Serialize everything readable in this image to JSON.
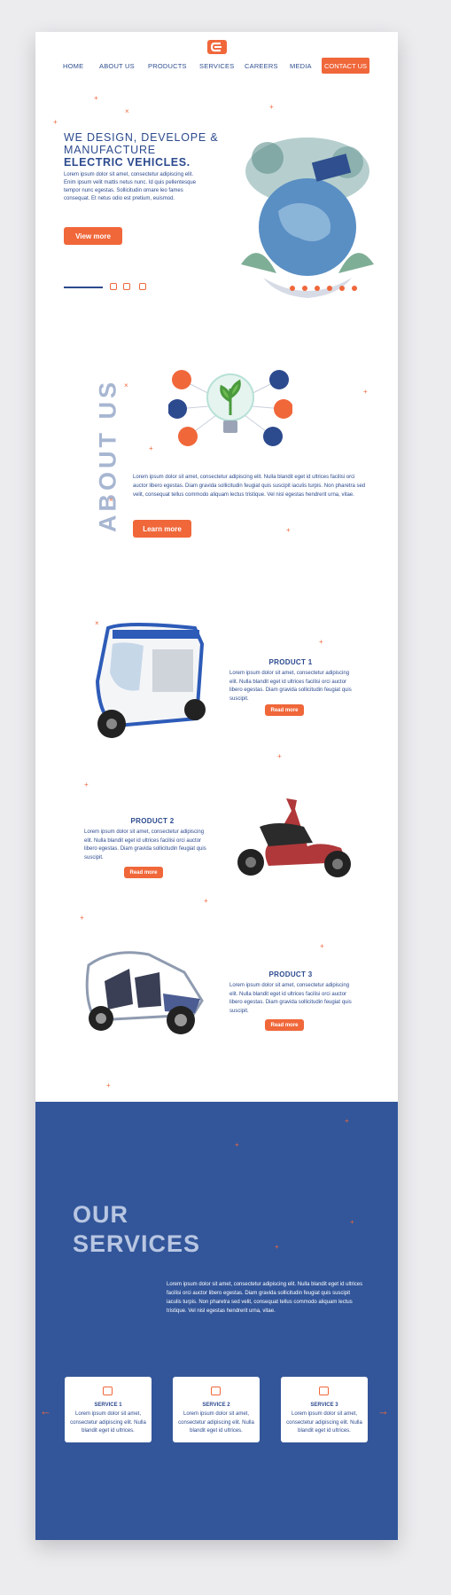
{
  "nav": {
    "items": [
      "HOME",
      "ABOUT US",
      "PRODUCTS",
      "SERVICES",
      "CAREERS",
      "MEDIA"
    ],
    "contact": "CONTACT US"
  },
  "hero": {
    "line1": "WE DESIGN, DEVELOPE &",
    "line2": "MANUFACTURE",
    "line3": "ELECTRIC VEHICLES.",
    "text": "Lorem ipsum dolor sit amet, consectetur adipiscing elit. Enim ipsum velit mattis netus nunc. Id quis pellentesque tempor nunc egestas. Sollicitudin ornare leo fames consequat. Et netus odio est pretium, euismod.",
    "button": "View more"
  },
  "about": {
    "heading": "ABOUT US",
    "text": "Lorem ipsum dolor sit amet, consectetur adipiscing elit. Nulla blandit eget id ultrices facilisi orci auctor libero egestas. Diam gravida sollicitudin feugiat quis suscipit iaculis turpis. Non pharetra sed velit, consequat tellus commodo aliquam lectus tristique. Vel nisl egestas hendrerit urna, vitae.",
    "button": "Learn more"
  },
  "products": [
    {
      "title": "PRODUCT 1",
      "text": "Lorem ipsum dolor sit amet, consectetur adipiscing elit. Nulla blandit eget id ultrices facilisi orci auctor libero egestas. Diam gravida sollicitudin feugiat quis suscipit.",
      "button": "Read more"
    },
    {
      "title": "PRODUCT 2",
      "text": "Lorem ipsum dolor sit amet, consectetur adipiscing elit. Nulla blandit eget id ultrices facilisi orci auctor libero egestas. Diam gravida sollicitudin feugiat quis suscipit.",
      "button": "Read more"
    },
    {
      "title": "PRODUCT 3",
      "text": "Lorem ipsum dolor sit amet, consectetur adipiscing elit. Nulla blandit eget id ultrices facilisi orci auctor libero egestas. Diam gravida sollicitudin feugiat quis suscipit.",
      "button": "Read more"
    }
  ],
  "services": {
    "heading1": "OUR",
    "heading2": "SERVICES",
    "text": "Lorem ipsum dolor sit amet, consectetur adipiscing elit. Nulla blandit eget id ultrices facilisi orci auctor libero egestas. Diam gravida sollicitudin feugiat quis suscipit iaculis turpis. Non pharetra sed velit, consequat tellus commodo aliquam lectus tristique. Vel nisl egestas hendrerit urna, vitae.",
    "cards": [
      {
        "title": "SERVICE 1",
        "text": "Lorem ipsum dolor sit amet, consectetur adipiscing elit. Nulla blandit eget id ultrices."
      },
      {
        "title": "SERVICE 2",
        "text": "Lorem ipsum dolor sit amet, consectetur adipiscing elit. Nulla blandit eget id ultrices."
      },
      {
        "title": "SERVICE 3",
        "text": "Lorem ipsum dolor sit amet, consectetur adipiscing elit. Nulla blandit eget id ultrices."
      }
    ]
  },
  "icons": {
    "prev": "arrow-left-icon",
    "next": "arrow-right-icon",
    "social": [
      "facebook-icon",
      "instagram-icon",
      "linkedin-icon"
    ]
  },
  "colors": {
    "accent": "#f0673a",
    "primary": "#2c4a8e",
    "services_bg": "#33569a"
  }
}
